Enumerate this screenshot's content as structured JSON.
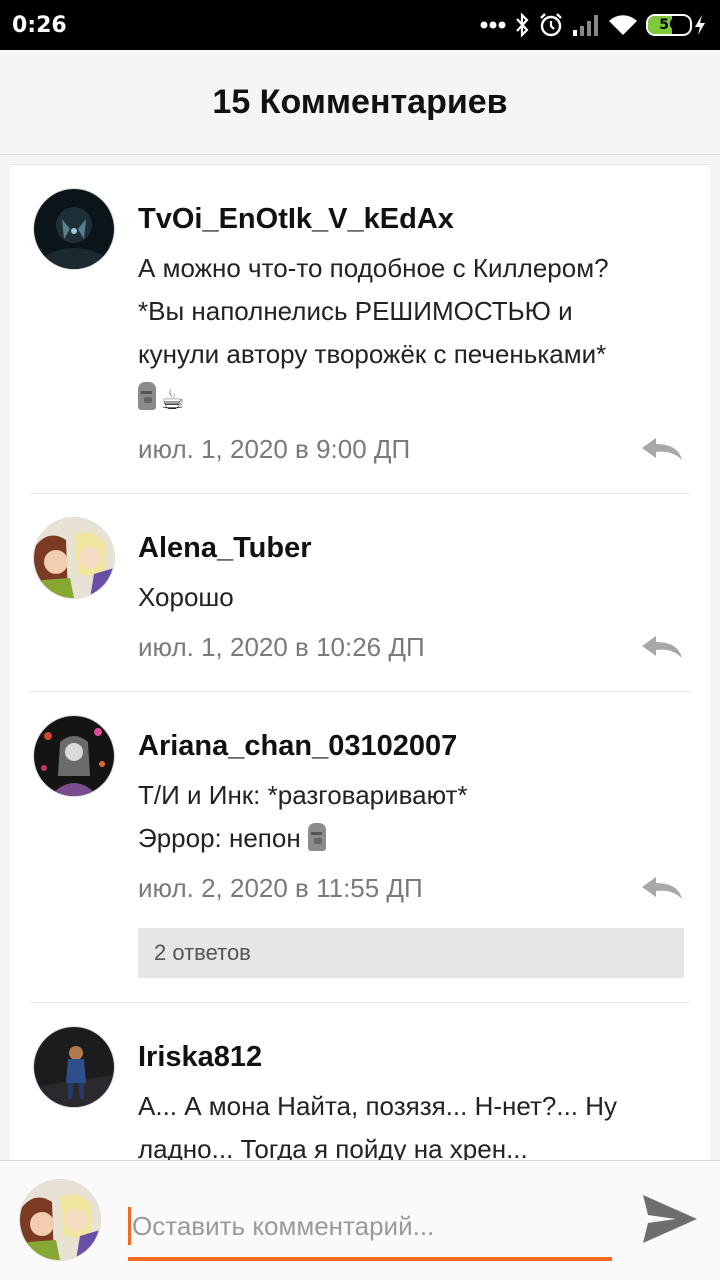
{
  "status_bar": {
    "time": "0:26",
    "battery": "56",
    "battery_level": 0.56,
    "icons": [
      "dots-icon",
      "bluetooth-icon",
      "alarm-icon",
      "signal-icon",
      "wifi-icon",
      "battery-icon",
      "charging-icon"
    ]
  },
  "header": {
    "title": "15 Комментариев"
  },
  "comments": [
    {
      "username": "TvOi_EnOtIk_V_kEdAx",
      "lines": [
        "А можно что-то подобное с Киллером?",
        "*Вы наполнелись РЕШИМОСТЬЮ и",
        "кунули автору творожёк с печеньками*"
      ],
      "emoji": [
        "moai-emoji",
        "coffee-emoji"
      ],
      "date": "июл. 1, 2020 в 9:00 ДП"
    },
    {
      "username": "Alena_Tuber",
      "lines": [
        "Хорошо"
      ],
      "date": "июл. 1, 2020 в 10:26 ДП"
    },
    {
      "username": "Ariana_chan_03102007",
      "lines": [
        "Т/И и Инк: *разговаривают*",
        "Эррор: непон"
      ],
      "date": "июл. 2, 2020 в 11:55 ДП",
      "replies": "2 ответов"
    },
    {
      "username": "Iriska812",
      "lines": [
        "А... А мона Найта, позязя... Н-нет?... Ну",
        "ладно... Тогда я пойду на хрен..."
      ]
    }
  ],
  "composer": {
    "placeholder": "Оставить комментарий..."
  },
  "colors": {
    "accent": "#f26b21",
    "battery": "#7ec93c"
  }
}
